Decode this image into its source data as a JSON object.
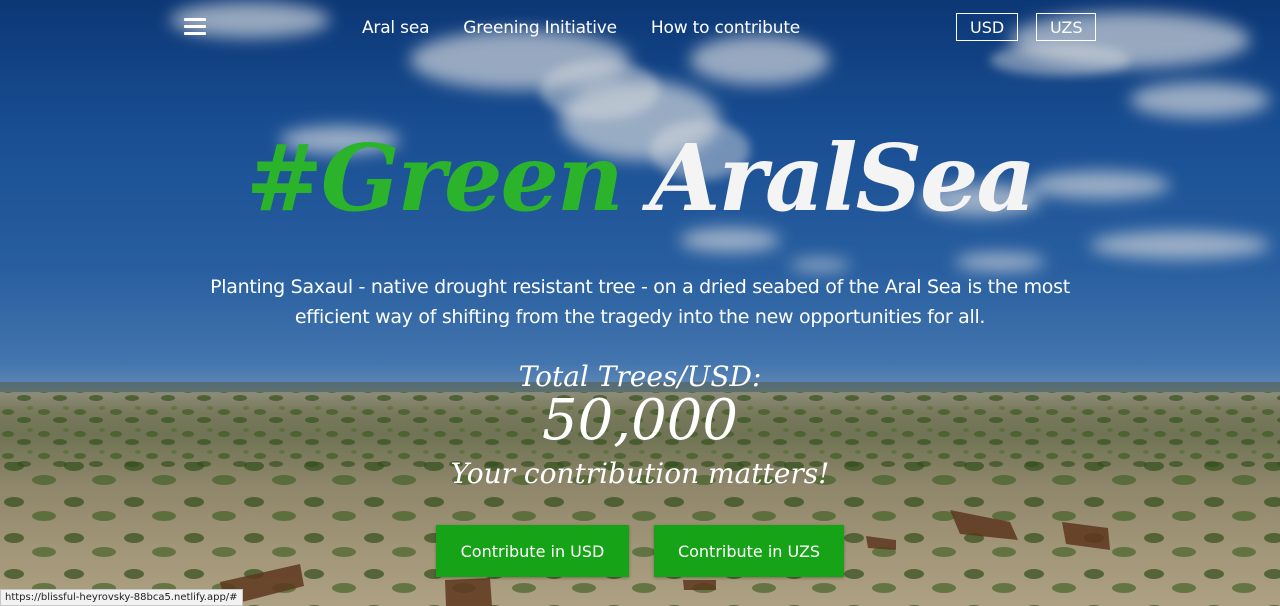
{
  "nav": {
    "menu_icon": "hamburger-menu-icon",
    "links": [
      "Aral sea",
      "Greening Initiative",
      "How to contribute"
    ],
    "currency_usd": "USD",
    "currency_uzs": "UZS"
  },
  "hero": {
    "title_green": "#Green",
    "title_white": "AralSea",
    "subtitle": "Planting Saxaul - native drought resistant tree - on a dried seabed of the Aral Sea is the most efficient way of shifting from the tragedy into the new opportunities for all.",
    "total_label": "Total Trees/USD:",
    "total_value": "50,000",
    "tagline": "Your contribution matters!",
    "cta_usd": "Contribute in USD",
    "cta_uzs": "Contribute in UZS"
  },
  "status_bar": {
    "url": "https://blissful-heyrovsky-88bca5.netlify.app/#"
  },
  "colors": {
    "accent_green": "#17a317",
    "title_green": "#2bb32b",
    "text_white": "#ffffff"
  }
}
